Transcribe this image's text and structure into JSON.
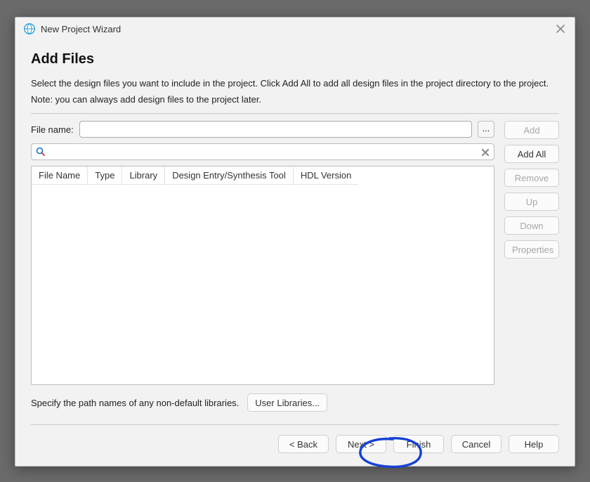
{
  "window": {
    "title": "New Project Wizard"
  },
  "page": {
    "heading": "Add Files",
    "description": "Select the design files you want to include in the project. Click Add All to add all design files in the project directory to the project.",
    "note": "Note: you can always add design files to the project later."
  },
  "filename": {
    "label": "File name:",
    "value": "",
    "browse": "..."
  },
  "filter": {
    "value": ""
  },
  "table": {
    "columns": [
      "File Name",
      "Type",
      "Library",
      "Design Entry/Synthesis Tool",
      "HDL Version"
    ],
    "rows": []
  },
  "side_buttons": {
    "add": "Add",
    "add_all": "Add All",
    "remove": "Remove",
    "up": "Up",
    "down": "Down",
    "properties": "Properties"
  },
  "libraries": {
    "label": "Specify the path names of any non-default libraries.",
    "button": "User Libraries..."
  },
  "footer": {
    "back": "< Back",
    "next": "Next >",
    "finish": "Finish",
    "cancel": "Cancel",
    "help": "Help"
  }
}
